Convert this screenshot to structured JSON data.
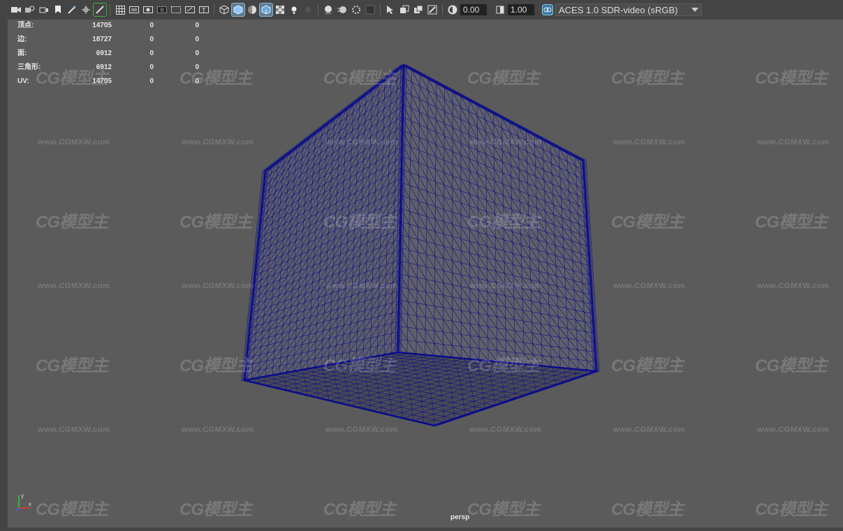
{
  "toolbar": {
    "icons": [
      "camera-icon",
      "camera-attributes-icon",
      "bookmark-icon",
      "image-plane-icon",
      "2d-pan-zoom-icon",
      "grease-pencil-icon",
      "grid-icon",
      "film-gate-icon",
      "resolution-gate-icon",
      "gate-mask-icon",
      "field-chart-icon",
      "safe-action-icon",
      "safe-title-icon",
      "wireframe-icon",
      "smooth-shade-icon",
      "default-material-icon",
      "shaded-wireframe-icon",
      "textured-icon",
      "use-all-lights-icon",
      "shadows-icon",
      "screen-space-ao-icon",
      "motion-blur-icon",
      "anti-aliasing-icon",
      "depth-of-field-icon",
      "isolate-select-icon",
      "xray-icon",
      "xray-joints-icon",
      "backface-culling-icon",
      "exposure-icon",
      "gamma-icon",
      "color-management-icon"
    ],
    "exposure_value": "0.00",
    "gamma_value": "1.00",
    "color_space": "ACES 1.0 SDR-video (sRGB)"
  },
  "hud": {
    "rows": [
      {
        "label": "顶点:",
        "v1": "14705",
        "v2": "0",
        "v3": "0"
      },
      {
        "label": "边:",
        "v1": "18727",
        "v2": "0",
        "v3": "0"
      },
      {
        "label": "面:",
        "v1": "6912",
        "v2": "0",
        "v3": "0"
      },
      {
        "label": "三角形:",
        "v1": "6912",
        "v2": "0",
        "v3": "0"
      },
      {
        "label": "UV:",
        "v1": "14705",
        "v2": "0",
        "v3": "0"
      }
    ]
  },
  "viewport": {
    "camera": "persp",
    "background": "#5b5b5b",
    "wire_color": "#0c0f8a",
    "axis_labels": {
      "y": "y",
      "x": "x"
    }
  },
  "watermark": {
    "logo": "CG模型主",
    "url": "www.CGMXW.com"
  }
}
